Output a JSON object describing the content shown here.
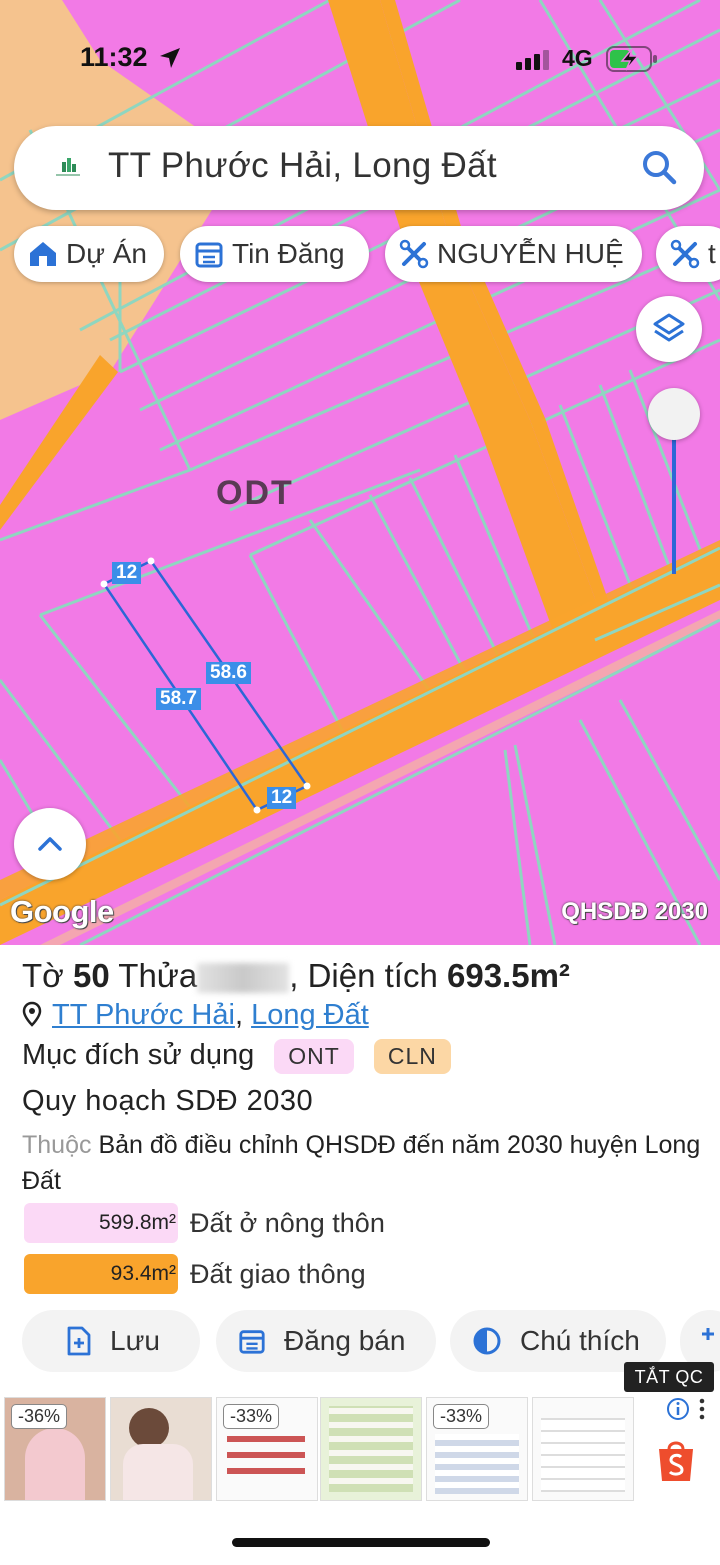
{
  "status_bar": {
    "time": "11:32",
    "network": "4G"
  },
  "search": {
    "query": "TT Phước Hải, Long Đất"
  },
  "chips": [
    {
      "label": "Dự Án",
      "icon": "house-icon"
    },
    {
      "label": "Tin Đăng",
      "icon": "calendar-icon"
    },
    {
      "label": "NGUYỄN HUỆ",
      "icon": "tools-icon"
    },
    {
      "label": "t",
      "icon": "tools-icon"
    }
  ],
  "map": {
    "zone_label": "ODT",
    "dimensions": [
      "12",
      "58.6",
      "58.7",
      "12"
    ],
    "google_logo": "Google",
    "badge": "QHSDĐ 2030",
    "colors": {
      "residential": "#f27ae6",
      "road": "#f9a42c",
      "agri": "#f5c38e",
      "parcel_line": "#8fd6c0",
      "selected": "#2c67d6"
    }
  },
  "parcel": {
    "title_prefix": "Tờ",
    "sheet_no": "50",
    "plot_label": "Thửa",
    "area_label": ", Diện tích",
    "area_value": "693.5m²",
    "address_commune": "TT Phước Hải",
    "address_sep": ",",
    "address_district": "Long Đất",
    "purpose_label": "Mục đích sử dụng",
    "purpose_tags": [
      "ONT",
      "CLN"
    ],
    "plan_title": "Quy hoạch SDĐ 2030",
    "belong_muted": "Thuộc",
    "belong_text": "Bản đồ điều chỉnh QHSDĐ đến năm 2030 huyện Long Đất",
    "legend": [
      {
        "area": "599.8m²",
        "label": "Đất ở nông thôn",
        "color": "#fbd9f6"
      },
      {
        "area": "93.4m²",
        "label": "Đất giao thông",
        "color": "#f9a42c"
      }
    ]
  },
  "actions": [
    {
      "label": "Lưu",
      "icon": "add-file-icon"
    },
    {
      "label": "Đăng bán",
      "icon": "calendar-icon"
    },
    {
      "label": "Chú thích",
      "icon": "half-circle-icon"
    }
  ],
  "ads": {
    "close_label": "TẮT QC",
    "discounts": [
      "-36%",
      "-33%",
      "-33%"
    ]
  }
}
